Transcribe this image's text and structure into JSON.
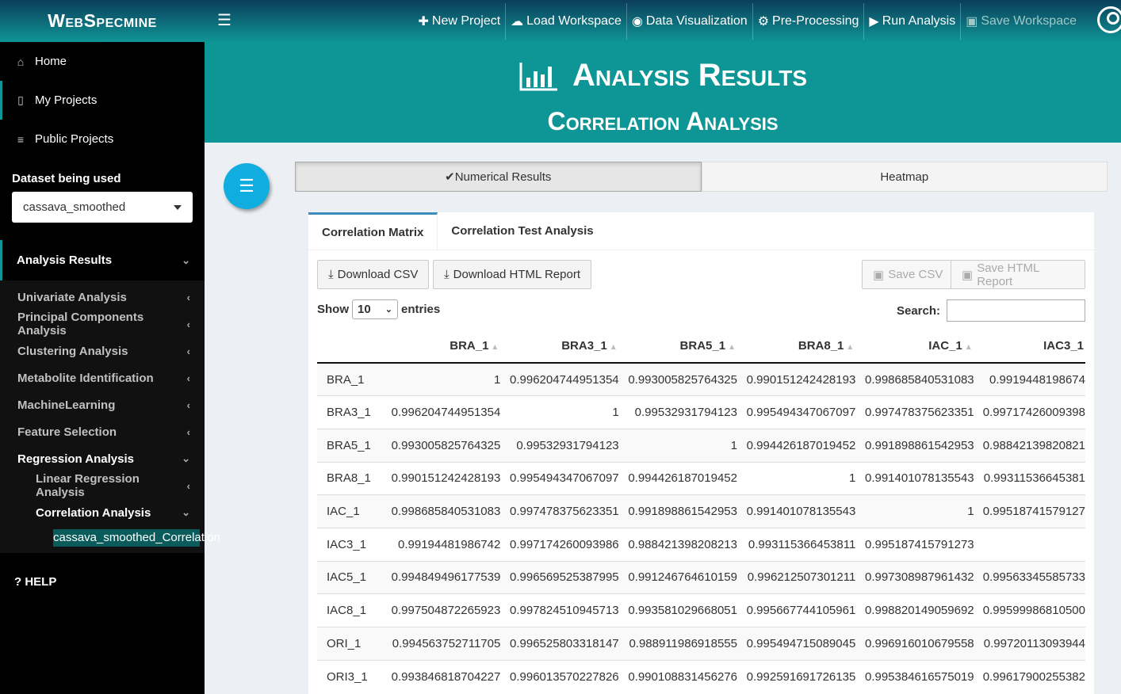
{
  "brand": "WebSpecmine",
  "topnav": [
    {
      "icon": "plus-icon",
      "glyph": "✚",
      "label": "New Project",
      "enabled": true
    },
    {
      "icon": "cloud-upload-icon",
      "glyph": "☁",
      "label": "Load Workspace",
      "enabled": true
    },
    {
      "icon": "eye-icon",
      "glyph": "◉",
      "label": "Data Visualization",
      "enabled": true
    },
    {
      "icon": "cogs-icon",
      "glyph": "⚙",
      "label": "Pre-Processing",
      "enabled": true
    },
    {
      "icon": "play-icon",
      "glyph": "▶",
      "label": "Run Analysis",
      "enabled": true
    },
    {
      "icon": "save-icon",
      "glyph": "▣",
      "label": "Save Workspace",
      "enabled": false
    }
  ],
  "sidebar": {
    "items": [
      {
        "icon": "home-icon",
        "glyph": "⌂",
        "label": "Home"
      },
      {
        "icon": "file-icon",
        "glyph": "▯",
        "label": "My Projects"
      },
      {
        "icon": "database-icon",
        "glyph": "≡",
        "label": "Public Projects"
      }
    ],
    "dataset_label": "Dataset being used",
    "dataset_value": "cassava_smoothed",
    "analysis_results": "Analysis Results",
    "submenu": [
      "Univariate Analysis",
      "Principal Components Analysis",
      "Clustering Analysis",
      "Metabolite Identification",
      "MachineLearning",
      "Feature Selection"
    ],
    "regression": "Regression Analysis",
    "linear": "Linear Regression Analysis",
    "correlation": "Correlation Analysis",
    "leaf": "cassava_smoothed_Correlation",
    "help": "? HELP"
  },
  "header": {
    "title": "Analysis Results",
    "subtitle": "Correlation Analysis"
  },
  "top_tabs": {
    "numerical": "Numerical Results",
    "heatmap": "Heatmap"
  },
  "panel_tabs": {
    "matrix": "Correlation Matrix",
    "test": "Correlation Test Analysis"
  },
  "buttons": {
    "download_csv": "Download CSV",
    "download_html": "Download HTML Report",
    "save_csv": "Save CSV",
    "save_html": "Save HTML Report"
  },
  "table_controls": {
    "show": "Show",
    "entries_value": "10",
    "entries": "entries",
    "search": "Search:"
  },
  "table": {
    "columns": [
      "",
      "BRA_1",
      "BRA3_1",
      "BRA5_1",
      "BRA8_1",
      "IAC_1",
      "IAC3_1"
    ],
    "rows": [
      [
        "BRA_1",
        "1",
        "0.996204744951354",
        "0.993005825764325",
        "0.990151242428193",
        "0.998685840531083",
        "0.9919448198674"
      ],
      [
        "BRA3_1",
        "0.996204744951354",
        "1",
        "0.99532931794123",
        "0.995494347067097",
        "0.997478375623351",
        "0.99717426009398"
      ],
      [
        "BRA5_1",
        "0.993005825764325",
        "0.99532931794123",
        "1",
        "0.994426187019452",
        "0.991898861542953",
        "0.98842139820821"
      ],
      [
        "BRA8_1",
        "0.990151242428193",
        "0.995494347067097",
        "0.994426187019452",
        "1",
        "0.991401078135543",
        "0.99311536645381"
      ],
      [
        "IAC_1",
        "0.998685840531083",
        "0.997478375623351",
        "0.991898861542953",
        "0.991401078135543",
        "1",
        "0.99518741579127"
      ],
      [
        "IAC3_1",
        "0.99194481986742",
        "0.997174260093986",
        "0.988421398208213",
        "0.993115366453811",
        "0.995187415791273",
        ""
      ],
      [
        "IAC5_1",
        "0.994849496177539",
        "0.996569525387995",
        "0.991246764610159",
        "0.996212507301211",
        "0.997308987961432",
        "0.99563345585733"
      ],
      [
        "IAC8_1",
        "0.997504872265923",
        "0.997824510945713",
        "0.993581029668051",
        "0.995667744105961",
        "0.998820149059692",
        "0.99599986810500"
      ],
      [
        "ORI_1",
        "0.994563752711705",
        "0.996525803318147",
        "0.988911986918555",
        "0.995494715089045",
        "0.996916010679558",
        "0.99720113093944"
      ],
      [
        "ORI3_1",
        "0.993846818704227",
        "0.996013570227826",
        "0.990108831456276",
        "0.992591691726135",
        "0.995384616575019",
        "0.99617900255382"
      ]
    ]
  }
}
